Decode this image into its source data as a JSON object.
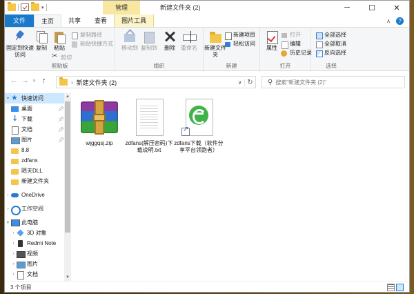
{
  "window": {
    "title": "新建文件夹 (2)",
    "tool_tab_header": "管理",
    "controls": [
      "─",
      "☐",
      "✕"
    ]
  },
  "tabs": {
    "file": "文件",
    "home": "主页",
    "share": "共享",
    "view": "查看",
    "tools": "图片工具"
  },
  "ribbon": {
    "clipboard": {
      "label": "剪贴板",
      "pin": "固定到快速访问",
      "copy": "复制",
      "paste": "粘贴",
      "copy_path": "复制路径",
      "paste_shortcut": "粘贴快捷方式",
      "cut": "剪切"
    },
    "organize": {
      "label": "组织",
      "move_to": "移动到",
      "copy_to": "复制到",
      "delete": "删除",
      "rename": "重命名"
    },
    "new": {
      "label": "新建",
      "new_folder": "新建文件夹",
      "new_item": "新建项目",
      "easy_access": "轻松访问"
    },
    "open": {
      "label": "打开",
      "properties": "属性",
      "open": "打开",
      "edit": "编辑",
      "history": "历史记录"
    },
    "select": {
      "label": "选择",
      "select_all": "全部选择",
      "select_none": "全部取消",
      "invert": "反向选择"
    }
  },
  "address": {
    "path": "新建文件夹 (2)",
    "search_placeholder": "搜索\"新建文件夹 (2)\""
  },
  "nav": {
    "quick_access": "快速访问",
    "desktop": "桌面",
    "downloads": "下载",
    "documents": "文档",
    "pictures": "图片",
    "f1": "8.8",
    "f2": "zdfans",
    "f3": "陌天DLL",
    "f4": "新建文件夹",
    "onedrive": "OneDrive",
    "workspace": "工作空间",
    "this_pc": "此电脑",
    "objects3d": "3D 对象",
    "redmi": "Redmi Note",
    "videos": "视频",
    "pictures2": "图片",
    "documents2": "文档"
  },
  "files": [
    {
      "name": "wjggqsj.zip",
      "icon": "winrar-archive-icon"
    },
    {
      "name": "zdfans(解压密码)下载说明.txt",
      "icon": "text-file-icon"
    },
    {
      "name": "zdfans下载（软件分享平台领跑者）",
      "icon": "ie-shortcut-icon"
    }
  ],
  "status": {
    "count": "3 个项目"
  },
  "colors": {
    "accent": "#1979ca",
    "tool_tab": "#f7e7a1",
    "selected_nav": "#cce8ff"
  }
}
